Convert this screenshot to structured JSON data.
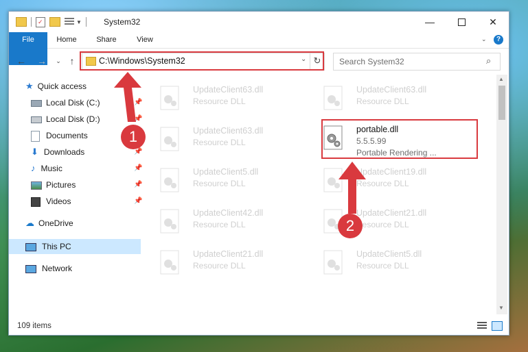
{
  "window": {
    "title": "System32",
    "quick_access_toolbar_icons": [
      "folder-icon",
      "properties-icon",
      "new-folder-icon",
      "customize-icon"
    ]
  },
  "ribbon": {
    "tabs": [
      "File",
      "Home",
      "Share",
      "View"
    ],
    "help_icon": "help-icon"
  },
  "address_bar": {
    "path": "C:\\Windows\\System32"
  },
  "search": {
    "placeholder": "Search System32"
  },
  "sidebar": {
    "items": [
      {
        "label": "Quick access",
        "icon": "star-icon"
      },
      {
        "label": "Local Disk (C:)",
        "icon": "drive-icon",
        "pinned": true
      },
      {
        "label": "Local Disk (D:)",
        "icon": "drive-icon",
        "pinned": true
      },
      {
        "label": "Documents",
        "icon": "document-icon",
        "pinned": true
      },
      {
        "label": "Downloads",
        "icon": "download-icon",
        "pinned": true
      },
      {
        "label": "Music",
        "icon": "music-icon",
        "pinned": true
      },
      {
        "label": "Pictures",
        "icon": "picture-icon",
        "pinned": true
      },
      {
        "label": "Videos",
        "icon": "video-icon",
        "pinned": true
      },
      {
        "label": "OneDrive",
        "icon": "cloud-icon"
      },
      {
        "label": "This PC",
        "icon": "computer-icon",
        "selected": true
      },
      {
        "label": "Network",
        "icon": "network-icon"
      }
    ]
  },
  "files": {
    "left_column": [
      {
        "name": "UpdateClient63.dll",
        "type": "Resource DLL"
      },
      {
        "name": "UpdateClient63.dll",
        "type": "Resource DLL"
      },
      {
        "name": "UpdateClient5.dll",
        "type": "Resource DLL"
      },
      {
        "name": "UpdateClient42.dll",
        "type": "Resource DLL"
      },
      {
        "name": "UpdateClient21.dll",
        "type": "Resource DLL"
      }
    ],
    "right_column": [
      {
        "name": "UpdateClient63.dll",
        "type": "Resource DLL"
      },
      {
        "name": "UpdateClient19.dll",
        "type": "Resource DLL"
      },
      {
        "name": "UpdateClient21.dll",
        "type": "Resource DLL"
      },
      {
        "name": "UpdateClient5.dll",
        "type": "Resource DLL"
      }
    ],
    "highlighted": {
      "name": "portable.dll",
      "version": "5.5.5.99",
      "description": "Portable Rendering ..."
    }
  },
  "status_bar": {
    "item_count": "109 items"
  },
  "annotations": {
    "step1": "1",
    "step2": "2"
  },
  "colors": {
    "accent": "#1979ca",
    "highlight": "#d9393e",
    "selected_bg": "#cce8ff"
  }
}
